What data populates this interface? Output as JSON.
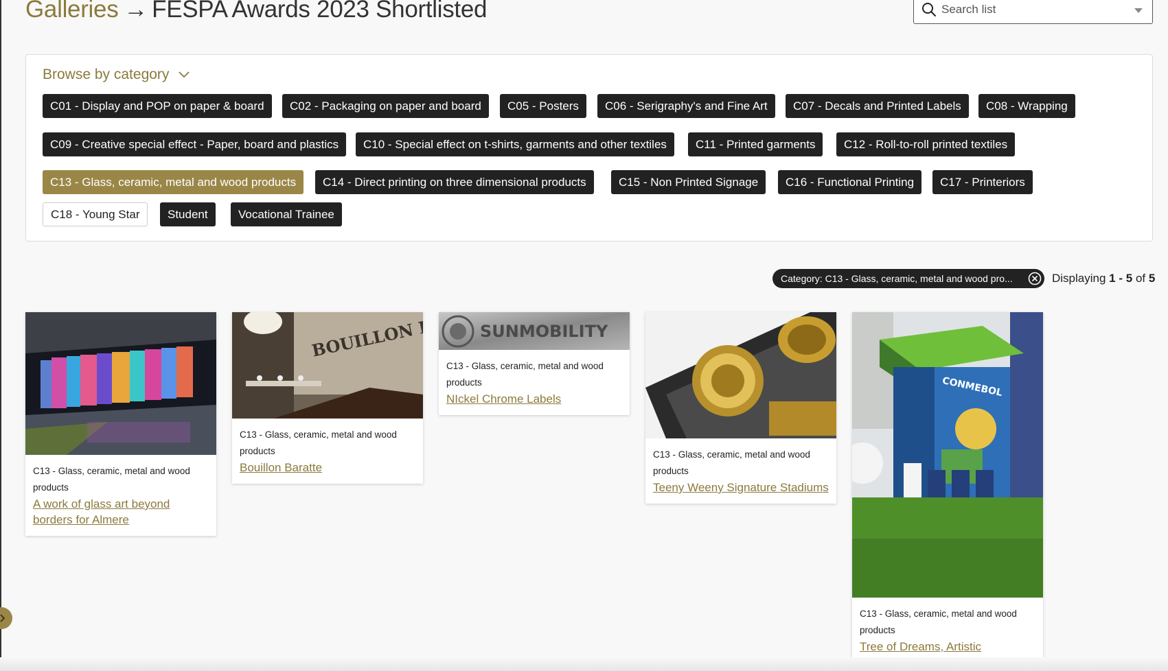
{
  "header": {
    "breadcrumb_link": "Galleries",
    "arrow": "→",
    "page_title": "FESPA Awards 2023 Shortlisted",
    "search_placeholder": "Search list"
  },
  "categories": {
    "toggle_label": "Browse by category",
    "chips": [
      "C01 - Display and POP on paper & board",
      "C02 - Packaging on paper and board",
      "C05 - Posters",
      "C06 - Serigraphy's and Fine Art",
      "C07 - Decals and Printed Labels",
      "C08 - Wrapping",
      "C09 - Creative special effect - Paper, board and plastics",
      "C10 - Special effect on t-shirts, garments and other textiles",
      "C11 - Printed garments",
      "C12 - Roll-to-roll printed textiles",
      "C13 - Glass, ceramic, metal and wood products",
      "C14 - Direct printing on three dimensional products",
      "C15 - Non Printed Signage",
      "C16 - Functional Printing",
      "C17 - Printeriors",
      "C18 - Young Star",
      "Student",
      "Vocational Trainee"
    ],
    "active_chip": "C13 - Glass, ceramic, metal and wood products"
  },
  "filter": {
    "pill_label": "Category: C13 - Glass, ceramic, metal and wood pro...",
    "display_prefix": "Displaying",
    "display_range": "1 - 5",
    "display_of": "of",
    "display_total": "5"
  },
  "cards": [
    {
      "category": "C13 - Glass, ceramic, metal and wood products",
      "title": "A work of glass art beyond borders for Almere"
    },
    {
      "category": "C13 - Glass, ceramic, metal and wood products",
      "title": "Bouillon Baratte",
      "image_text": "BOUILLON BARATTE"
    },
    {
      "category": "C13 - Glass, ceramic, metal and wood products",
      "title": "NIckel Chrome Labels",
      "image_text": "SUNMOBILITY"
    },
    {
      "category": "C13 - Glass, ceramic, metal and wood products",
      "title": "Teeny Weeny Signature Stadiums"
    },
    {
      "category": "C13 - Glass, ceramic, metal and wood products",
      "title": "Tree of Dreams, Artistic Installation - CONMEBOL",
      "image_text": "CONMEBOL"
    }
  ],
  "colors": {
    "accent": "#8b7a3c",
    "chip_dark": "#222222",
    "chip_active": "#9a8748"
  }
}
